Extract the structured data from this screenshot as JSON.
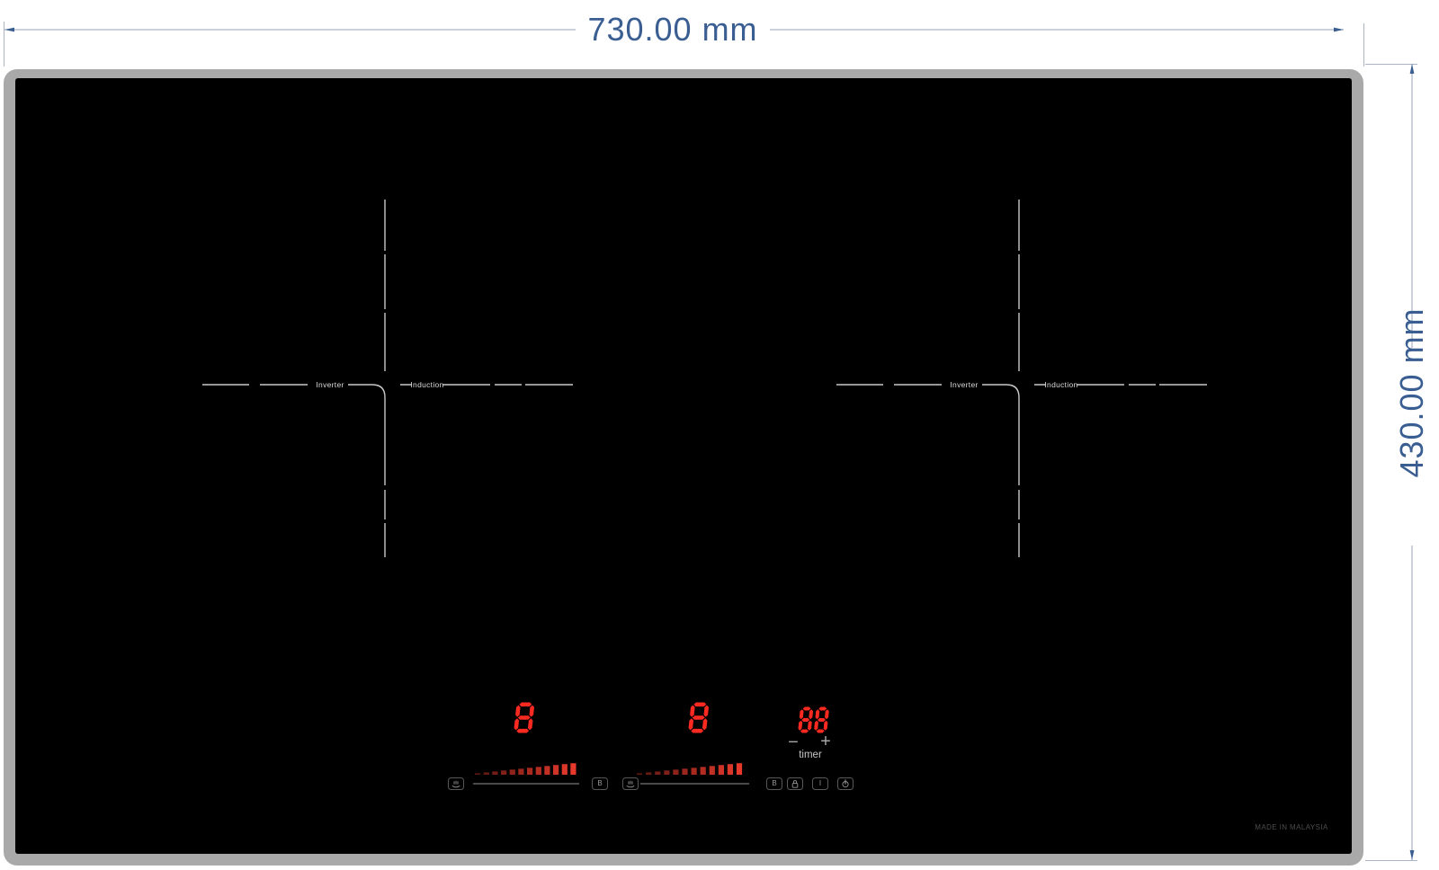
{
  "annotations": {
    "width_dim": "730.00 mm",
    "height_dim": "430.00 mm"
  },
  "cooktop": {
    "made_in": "MADE IN MALAYSIA",
    "zones": [
      {
        "left_label": "Inverter",
        "right_label": "Induction"
      },
      {
        "left_label": "Inverter",
        "right_label": "Induction"
      }
    ]
  },
  "control_panel": {
    "left_display": "8",
    "middle_display": "8",
    "timer_display": "88",
    "timer_label": "timer",
    "minus": "−",
    "plus": "+",
    "ramp_segment_count": 12,
    "buttons": [
      {
        "name": "warm-left",
        "icon": "pan-warm-icon"
      },
      {
        "name": "boost-left",
        "label": "B"
      },
      {
        "name": "warm-middle",
        "icon": "pan-warm-icon"
      },
      {
        "name": "boost-right",
        "label": "B"
      },
      {
        "name": "lock",
        "icon": "lock-icon"
      },
      {
        "name": "timer-select",
        "label": "I"
      },
      {
        "name": "power",
        "icon": "power-icon"
      }
    ]
  },
  "colors": {
    "led": "#fb2a20",
    "ramp": "#e6392b",
    "frame_gray": "#a9a9a9",
    "glass_black": "#000000",
    "dim_text_blue": "#3a5e92",
    "dim_line_gray": "#94a3b8",
    "zone_line_gray": "#c9c9c9"
  }
}
